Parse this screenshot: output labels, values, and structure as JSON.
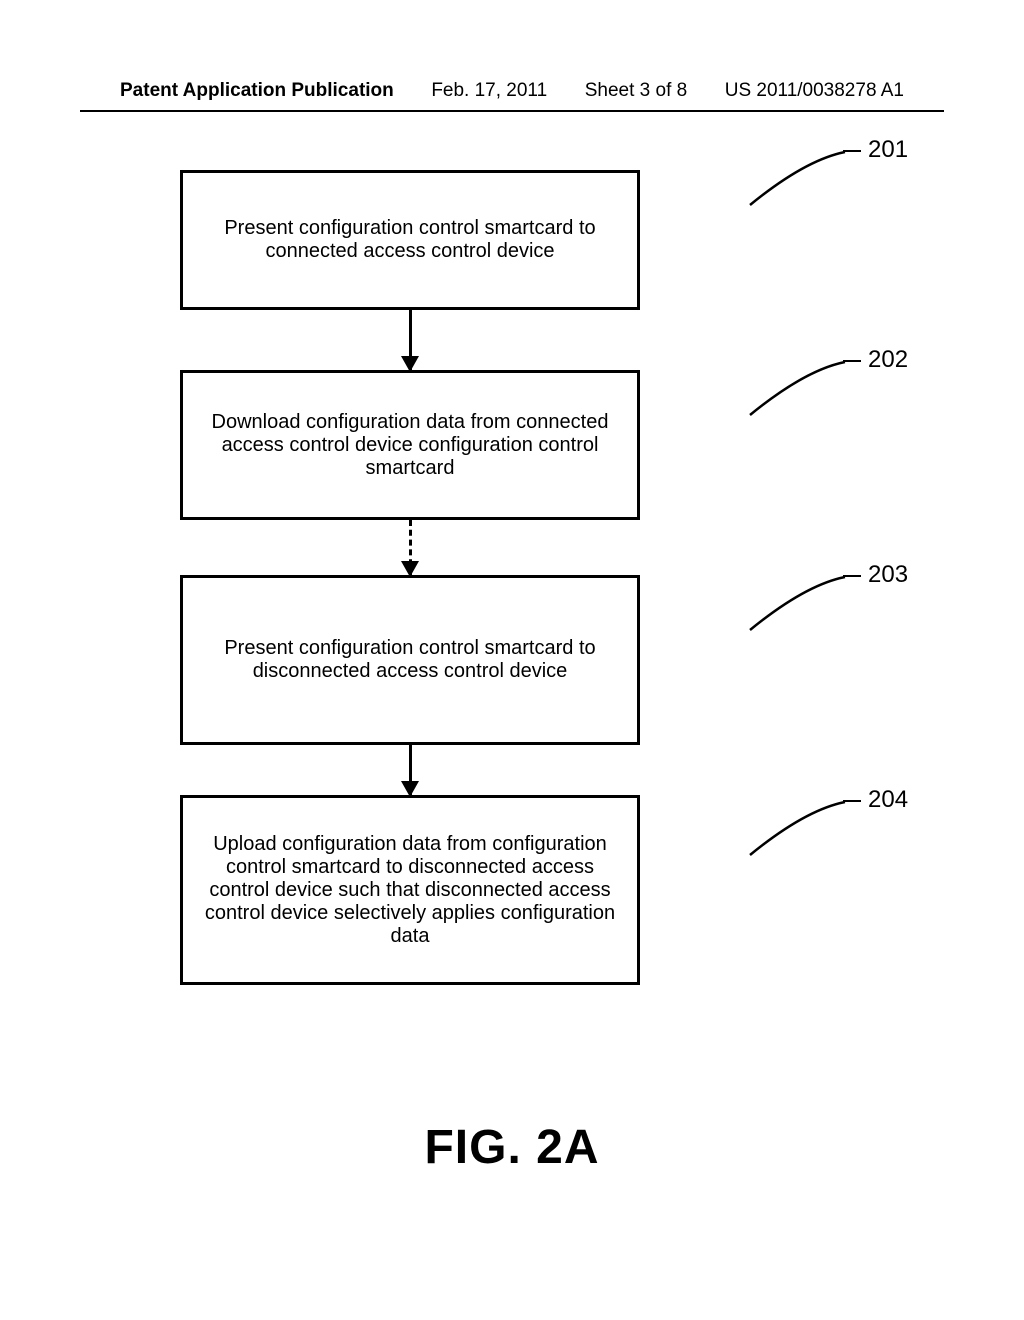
{
  "header": {
    "left": "Patent Application Publication",
    "mid_date": "Feb. 17, 2011",
    "mid_sheet": "Sheet 3 of 8",
    "right": "US 2011/0038278 A1"
  },
  "flow": {
    "steps": [
      {
        "ref": "201",
        "text": "Present configuration control smartcard to connected access control device"
      },
      {
        "ref": "202",
        "text": "Download configuration data from connected access control device configuration control smartcard"
      },
      {
        "ref": "203",
        "text": "Present configuration control smartcard to disconnected access control device"
      },
      {
        "ref": "204",
        "text": "Upload configuration data from configuration control smartcard to disconnected access control device such that disconnected access control device selectively applies configuration data"
      }
    ]
  },
  "figure_label": "FIG. 2A"
}
